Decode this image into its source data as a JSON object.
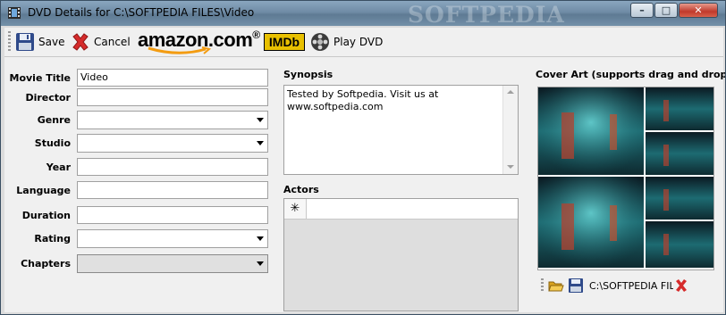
{
  "window": {
    "title": "DVD Details for C:\\SOFTPEDIA FILES\\Video",
    "watermark": "SOFTPEDIA",
    "minimize": "–",
    "maximize": "□",
    "close": "✕"
  },
  "toolbar": {
    "save_label": "Save",
    "cancel_label": "Cancel",
    "amazon_label": "amazon.com",
    "amazon_reg": "®",
    "imdb_label": "IMDb",
    "play_label": "Play DVD"
  },
  "form": {
    "movie_title_label": "Movie Title",
    "movie_title_value": "Video",
    "director_label": "Director",
    "director_value": "",
    "genre_label": "Genre",
    "genre_value": "",
    "studio_label": "Studio",
    "studio_value": "",
    "year_label": "Year",
    "year_value": "",
    "language_label": "Language",
    "language_value": "",
    "duration_label": "Duration",
    "duration_value": "",
    "rating_label": "Rating",
    "rating_value": "",
    "chapters_label": "Chapters",
    "chapters_value": ""
  },
  "synopsis": {
    "label": "Synopsis",
    "text": "Tested by Softpedia. Visit us at www.softpedia.com"
  },
  "actors": {
    "label": "Actors",
    "new_row_marker": "✳"
  },
  "cover_art": {
    "label": "Cover Art (supports drag and drop)",
    "path": "C:\\SOFTPEDIA FIL"
  },
  "colors": {
    "imdb_yellow": "#e8c000",
    "amazon_orange": "#f39c12",
    "cancel_red": "#d62b2b"
  }
}
